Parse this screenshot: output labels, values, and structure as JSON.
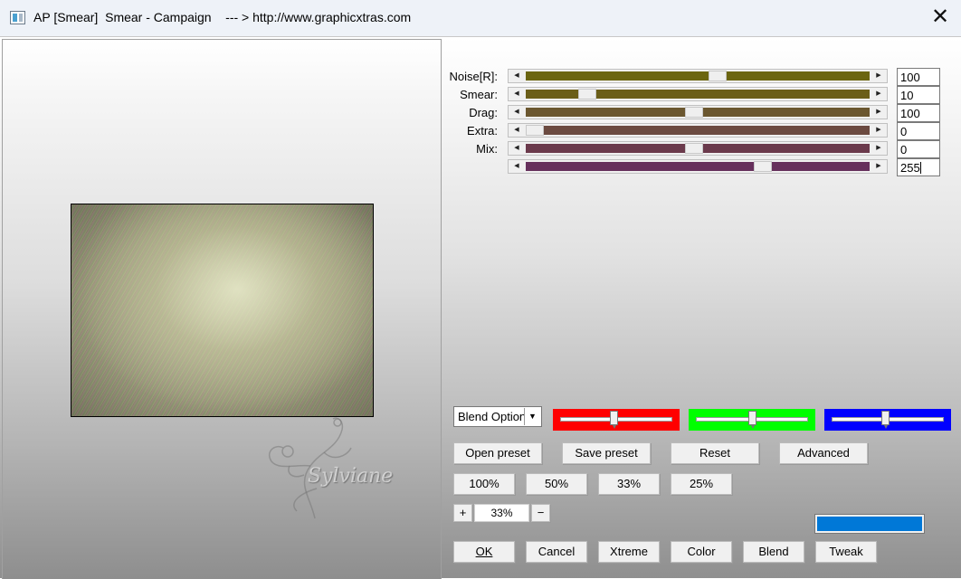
{
  "window": {
    "title": "AP [Smear]  Smear - Campaign    --- > http://www.graphicxtras.com",
    "close_label": "✕",
    "icon": "app-window-icon"
  },
  "preview": {
    "watermark_text": "Sylviane"
  },
  "sliders": [
    {
      "label": "Noise[R]:",
      "value": "100",
      "fill_color": "#6b6510",
      "position": 0.56
    },
    {
      "label": "Smear:",
      "value": "10",
      "fill_color": "#6b5e18",
      "position": 0.16
    },
    {
      "label": "Drag:",
      "value": "100",
      "fill_color": "#6b5730",
      "position": 0.49
    },
    {
      "label": "Extra:",
      "value": "0",
      "fill_color": "#6b4a40",
      "position": 0.0
    },
    {
      "label": "Mix:",
      "value": "0",
      "fill_color": "#6b3a4c",
      "position": 0.49
    },
    {
      "label": "",
      "value": "255",
      "fill_color": "#66305c",
      "position": 0.7
    }
  ],
  "blend": {
    "selected": "Blend Options",
    "red_color": "#ff0000",
    "red_position": 0.48,
    "green_color": "#00ff00",
    "green_position": 0.5,
    "blue_color": "#0000ff",
    "blue_position": 0.48
  },
  "buttons": {
    "open_preset": "Open preset",
    "save_preset": "Save preset",
    "reset": "Reset",
    "advanced": "Advanced",
    "zoom_100": "100%",
    "zoom_50": "50%",
    "zoom_33": "33%",
    "zoom_25": "25%",
    "zoom_in": "+",
    "zoom_out": "−",
    "ok": "OK",
    "cancel": "Cancel",
    "xtreme": "Xtreme",
    "color": "Color",
    "blend": "Blend",
    "tweak": "Tweak"
  },
  "zoom_value": "33%",
  "swatch_color": "#0078d7"
}
